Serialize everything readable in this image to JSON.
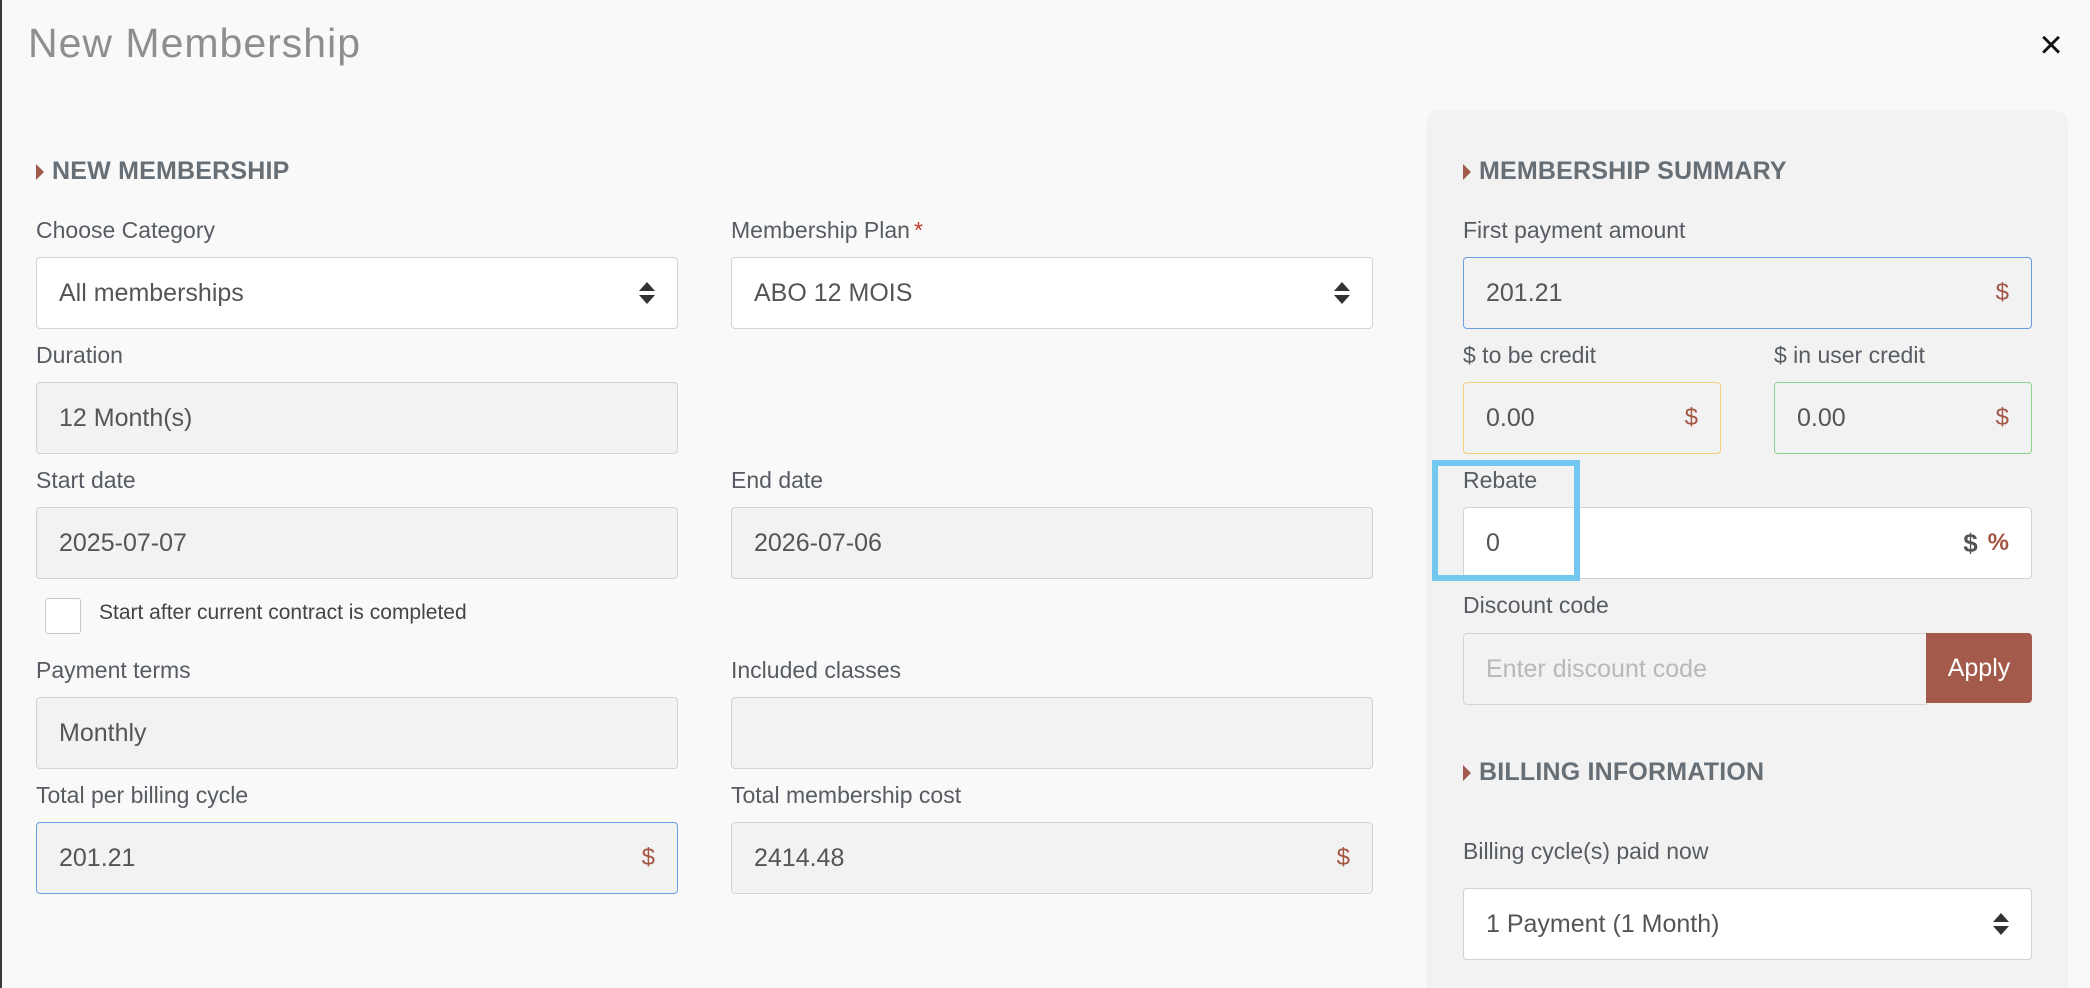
{
  "modal": {
    "title": "New Membership",
    "close_label": "×"
  },
  "new_membership": {
    "header": "NEW MEMBERSHIP",
    "choose_category": {
      "label": "Choose Category",
      "value": "All memberships"
    },
    "membership_plan": {
      "label": "Membership Plan",
      "required_mark": "*",
      "value": "ABO 12 MOIS"
    },
    "duration": {
      "label": "Duration",
      "value": "12 Month(s)"
    },
    "start_date": {
      "label": "Start date",
      "value": "2025-07-07"
    },
    "end_date": {
      "label": "End date",
      "value": "2026-07-06"
    },
    "start_after_checkbox": {
      "label": "Start after current contract is completed",
      "checked": false
    },
    "payment_terms": {
      "label": "Payment terms",
      "value": "Monthly"
    },
    "included_classes": {
      "label": "Included classes",
      "value": ""
    },
    "total_per_billing_cycle": {
      "label": "Total per billing cycle",
      "value": "201.21",
      "currency": "$"
    },
    "total_membership_cost": {
      "label": "Total membership cost",
      "value": "2414.48",
      "currency": "$"
    }
  },
  "membership_summary": {
    "header": "MEMBERSHIP SUMMARY",
    "first_payment": {
      "label": "First payment amount",
      "value": "201.21",
      "currency": "$"
    },
    "to_be_credit": {
      "label": "$ to be credit",
      "value": "0.00",
      "currency": "$"
    },
    "in_user_credit": {
      "label": "$ in user credit",
      "value": "0.00",
      "currency": "$"
    },
    "rebate": {
      "label": "Rebate",
      "value": "0",
      "unit_dollar": "$",
      "unit_percent": "%"
    },
    "discount_code": {
      "label": "Discount code",
      "placeholder": "Enter discount code",
      "apply_label": "Apply"
    }
  },
  "billing_information": {
    "header": "BILLING INFORMATION",
    "billing_cycles": {
      "label": "Billing cycle(s) paid now",
      "value": "1 Payment (1 Month)"
    }
  },
  "colors": {
    "accent": "#a35a4b",
    "highlight": "#73c8ef",
    "blue_border": "#6c9de0",
    "yellow_border": "#f2cf7a",
    "green_border": "#8fd08f"
  }
}
